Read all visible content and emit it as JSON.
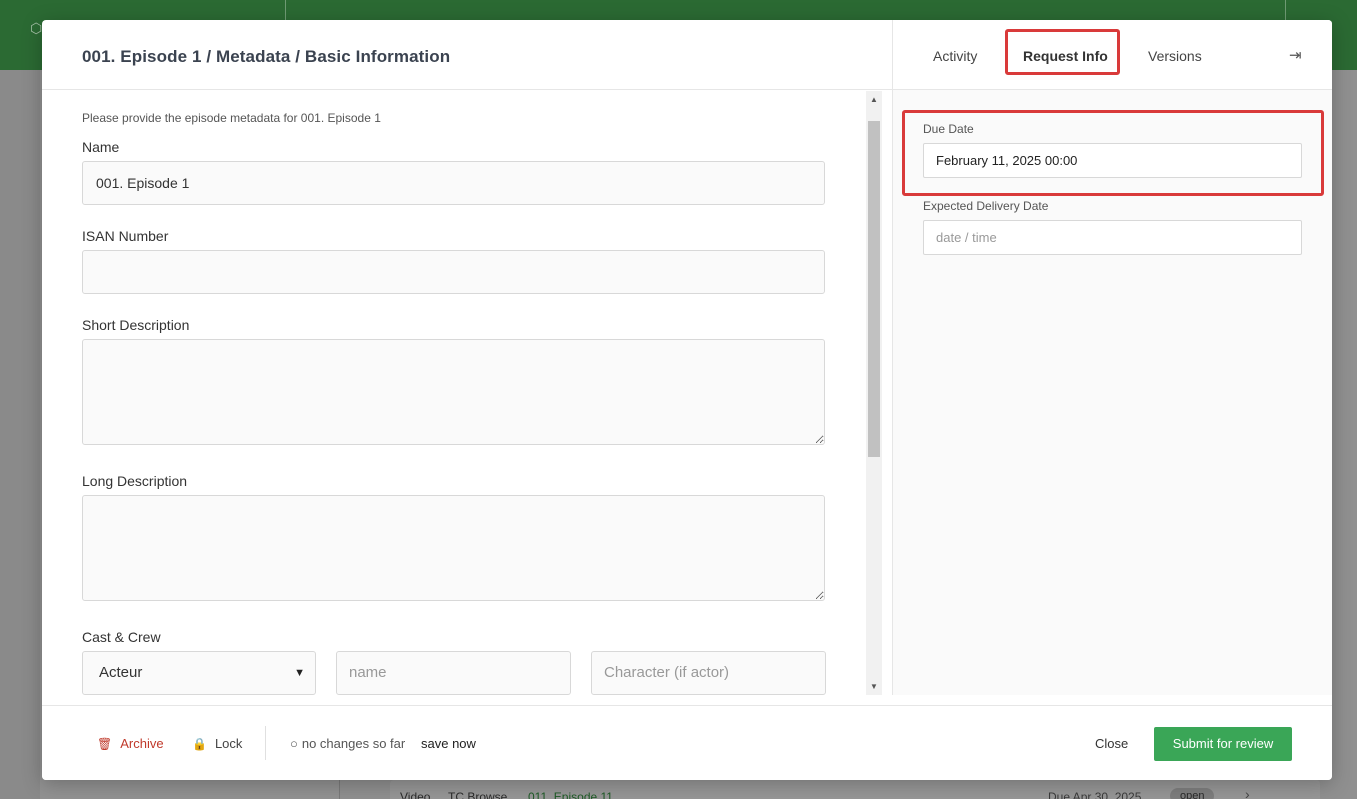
{
  "modal": {
    "title": "001. Episode 1 / Metadata / Basic Information",
    "intro": "Please provide the episode metadata for 001. Episode 1"
  },
  "form": {
    "name_label": "Name",
    "name_value": "001. Episode 1",
    "isan_label": "ISAN Number",
    "isan_value": "",
    "short_desc_label": "Short Description",
    "long_desc_label": "Long Description",
    "cast_label": "Cast & Crew",
    "cast_role_selected": "Acteur",
    "cast_name_placeholder": "name",
    "cast_character_placeholder": "Character (if actor)"
  },
  "right_panel": {
    "tabs": [
      "Activity",
      "Request Info",
      "Versions"
    ],
    "active_tab": "Request Info",
    "due_date_label": "Due Date",
    "due_date_value": "February 11, 2025 00:00",
    "expected_label": "Expected Delivery Date",
    "expected_placeholder": "date / time"
  },
  "footer": {
    "archive_label": "Archive",
    "lock_label": "Lock",
    "status_text": "no changes so far",
    "save_label": "save now",
    "close_label": "Close",
    "submit_label": "Submit for review"
  },
  "background": {
    "row_type": "Video",
    "row_kind": "TC Browse",
    "row_title": "011. Episode 11",
    "row_due": "Due Apr 30, 2025",
    "row_status": "open"
  },
  "colors": {
    "accent_green": "#3aa657",
    "header_green": "#2b6a33",
    "highlight_red": "#d93a3a",
    "archive_red": "#c0392b"
  },
  "icons": {
    "archive": "trash-icon",
    "lock": "lock-icon",
    "status": "circle-icon",
    "collapse": "collapse-panel-icon",
    "select": "chevron-down-icon"
  }
}
